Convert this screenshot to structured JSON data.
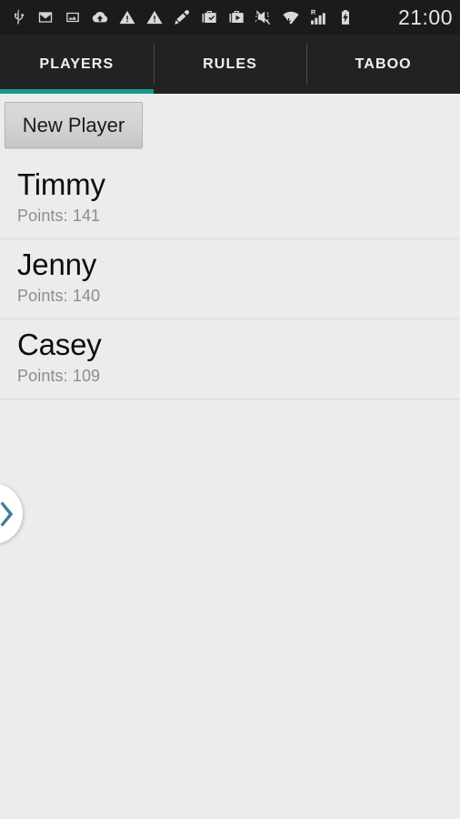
{
  "status_bar": {
    "background": "#1b1b1b",
    "clock": "21:00",
    "icons": [
      {
        "name": "usb-icon",
        "label": "USB connected"
      },
      {
        "name": "gmail-icon",
        "label": "Gmail notification"
      },
      {
        "name": "image-icon",
        "label": "Screenshot captured"
      },
      {
        "name": "cloud-upload-icon",
        "label": "Cloud upload"
      },
      {
        "name": "warning-triangle-icon",
        "label": "Warning"
      },
      {
        "name": "warning-triangle-icon-2",
        "label": "Warning"
      },
      {
        "name": "highlighter-pen-icon",
        "label": "Highlighter"
      },
      {
        "name": "briefcase-check-icon",
        "label": "Work profile checked"
      },
      {
        "name": "briefcase-play-icon",
        "label": "Work profile media"
      },
      {
        "name": "volume-vibrate-mute-icon",
        "label": "Ringer muted / vibrate"
      },
      {
        "name": "wifi-transfer-icon",
        "label": "Wi-Fi with data transfer"
      },
      {
        "name": "roaming-signal-icon",
        "label": "Roaming cellular signal"
      },
      {
        "name": "battery-charging-icon",
        "label": "Battery charging"
      }
    ]
  },
  "tabs": {
    "active_index": 0,
    "active_color": "#17998a",
    "items": [
      {
        "label": "PLAYERS"
      },
      {
        "label": "RULES"
      },
      {
        "label": "TABOO"
      }
    ]
  },
  "toolbar": {
    "new_player_label": "New Player"
  },
  "players": {
    "points_prefix": "Points: ",
    "items": [
      {
        "name": "Timmy",
        "points_line": "Points: 141",
        "points": 141
      },
      {
        "name": "Jenny",
        "points_line": "Points: 140",
        "points": 140
      },
      {
        "name": "Casey",
        "points_line": "Points: 109",
        "points": 109
      }
    ]
  },
  "edge_nav": {
    "icon": "chevron-right-icon",
    "color": "#3d7f99"
  }
}
